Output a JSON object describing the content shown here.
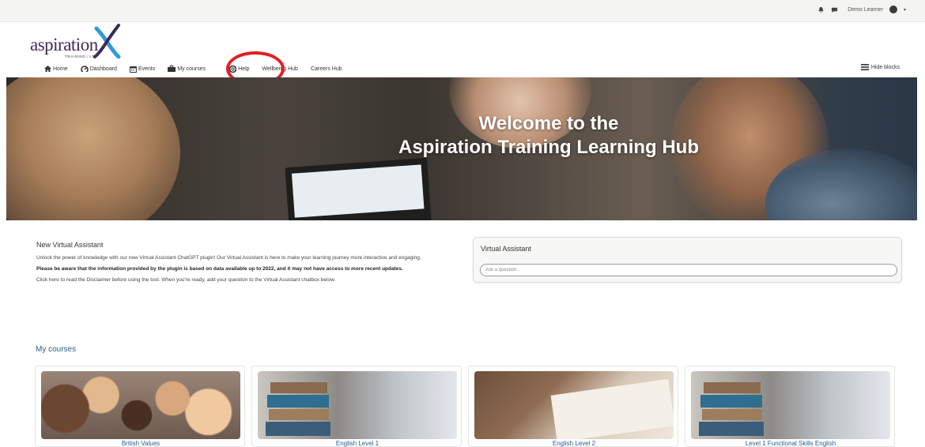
{
  "topbar": {
    "user_name": "Demo Learner"
  },
  "logo": {
    "word": "aspiration",
    "sub": "TRAINING ⁄ LTD"
  },
  "nav": {
    "items": [
      {
        "label": "Home",
        "icon": "home-icon"
      },
      {
        "label": "Dashboard",
        "icon": "dashboard-icon"
      },
      {
        "label": "Events",
        "icon": "calendar-icon"
      },
      {
        "label": "My courses",
        "icon": "briefcase-icon"
      },
      {
        "label": "Help",
        "icon": "help-icon"
      },
      {
        "label": "Wellbeing Hub",
        "icon": ""
      },
      {
        "label": "Careers Hub",
        "icon": ""
      }
    ],
    "hide_blocks": "Hide blocks"
  },
  "banner": {
    "line1": "Welcome to the",
    "line2": "Aspiration Training Learning Hub"
  },
  "intro": {
    "title": "New Virtual Assistant",
    "p1": "Unlock the power of knowledge with our new Virtual Assistant ChatGPT plugin! Our Virtual Assistant is here to make your learning journey more interactive and engaging.",
    "p2": "Please be aware that the information provided by the plugin is based on data available up to 2022, and it may not have access to more recent updates.",
    "p3": "Click here to read the Disclaimer before using the tool.  When you're ready, add your question to the Virtual Assistant chatbox below."
  },
  "assistant": {
    "title": "Virtual Assistant",
    "placeholder": "Ask a question..."
  },
  "courses": {
    "title": "My courses",
    "items": [
      {
        "name": "British Values"
      },
      {
        "name": "English Level 1"
      },
      {
        "name": "English Level 2"
      },
      {
        "name": "Level 1 Functional Skills English"
      }
    ]
  },
  "colors": {
    "accent_link": "#2a5d8a",
    "brand_purple": "#3d2a56",
    "annotation_red": "#e31e24"
  }
}
